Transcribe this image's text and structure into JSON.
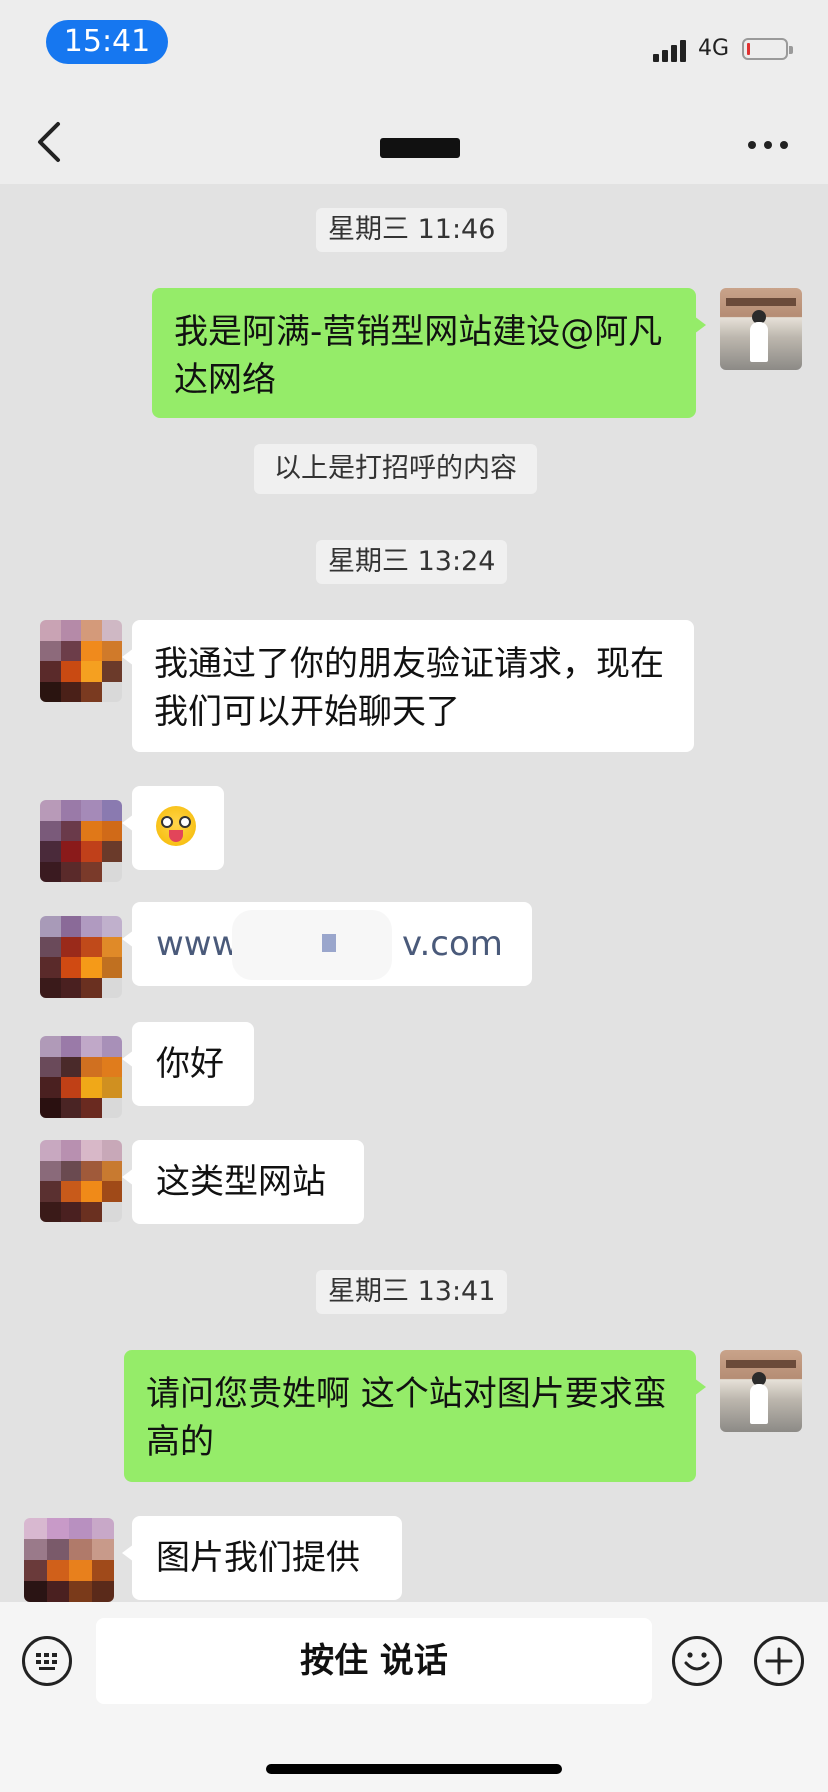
{
  "status_bar": {
    "time": "15:41",
    "network": "4G",
    "battery_level": 0.05
  },
  "nav": {
    "title": "",
    "back_icon": "chevron-left-icon",
    "more_icon": "more-icon"
  },
  "messages": {
    "ts1": "星期三 11:46",
    "msg1": "我是阿满-营销型网站建设@阿凡达网络",
    "notice1": "以上是打招呼的内容",
    "ts2": "星期三 13:24",
    "msg2": "我通过了你的朋友验证请求，现在我们可以开始聊天了",
    "msg3_emoji": "tongue-out-emoji",
    "msg4_prefix": "www.",
    "msg4_suffix": "v.com",
    "msg5": "你好",
    "msg6": "这类型网站",
    "ts3": "星期三 13:41",
    "msg7": "请问您贵姓啊 这个站对图片要求蛮高的",
    "msg8": "图片我们提供"
  },
  "input_bar": {
    "voice_label": "按住 说话",
    "keyboard_icon": "keyboard-icon",
    "emoji_icon": "emoji-icon",
    "plus_icon": "plus-icon"
  },
  "colors": {
    "outgoing_bubble": "#95ec69",
    "incoming_bubble": "#ffffff",
    "chat_background": "#e2e2e2",
    "time_pill": "#1677f0"
  }
}
